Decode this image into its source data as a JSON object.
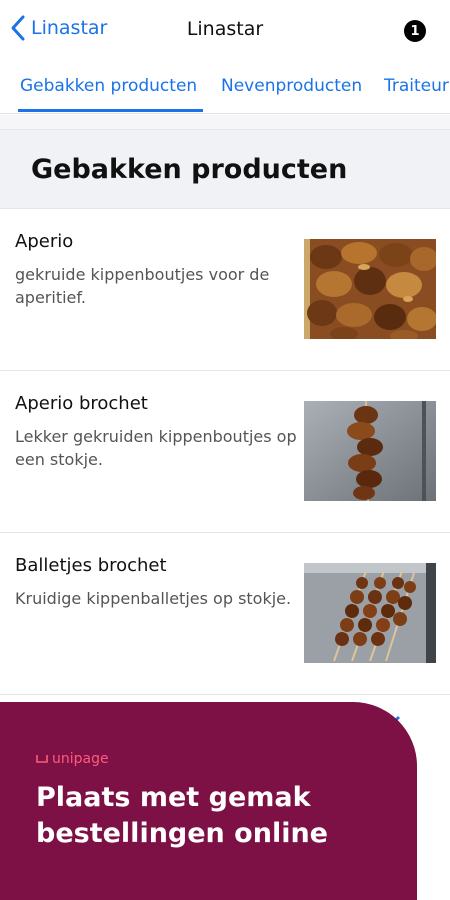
{
  "navbar": {
    "back_label": "Linastar",
    "title": "Linastar",
    "badge_count": "1",
    "accent_color": "#1a73e8"
  },
  "tabs": [
    {
      "label": "Gebakken producten",
      "active": true
    },
    {
      "label": "Nevenproducten",
      "active": false
    },
    {
      "label": "Traiteur",
      "active": false
    }
  ],
  "section": {
    "title": "Gebakken producten"
  },
  "products": [
    {
      "name": "Aperio",
      "description": "gekruide kippenboutjes voor de aperitief.",
      "image": "fried-chicken-pieces-photo"
    },
    {
      "name": "Aperio brochet",
      "description": "Lekker gekruiden kippenboutjes op een stokje.",
      "image": "chicken-skewer-photo"
    },
    {
      "name": "Balletjes brochet",
      "description": "Kruidige kippenballetjes op stokje.",
      "image": "meatball-skewers-photo"
    }
  ],
  "promo": {
    "brand": "unipage",
    "headline": "Plaats met gemak bestellingen online",
    "background_color": "#7d1044"
  }
}
